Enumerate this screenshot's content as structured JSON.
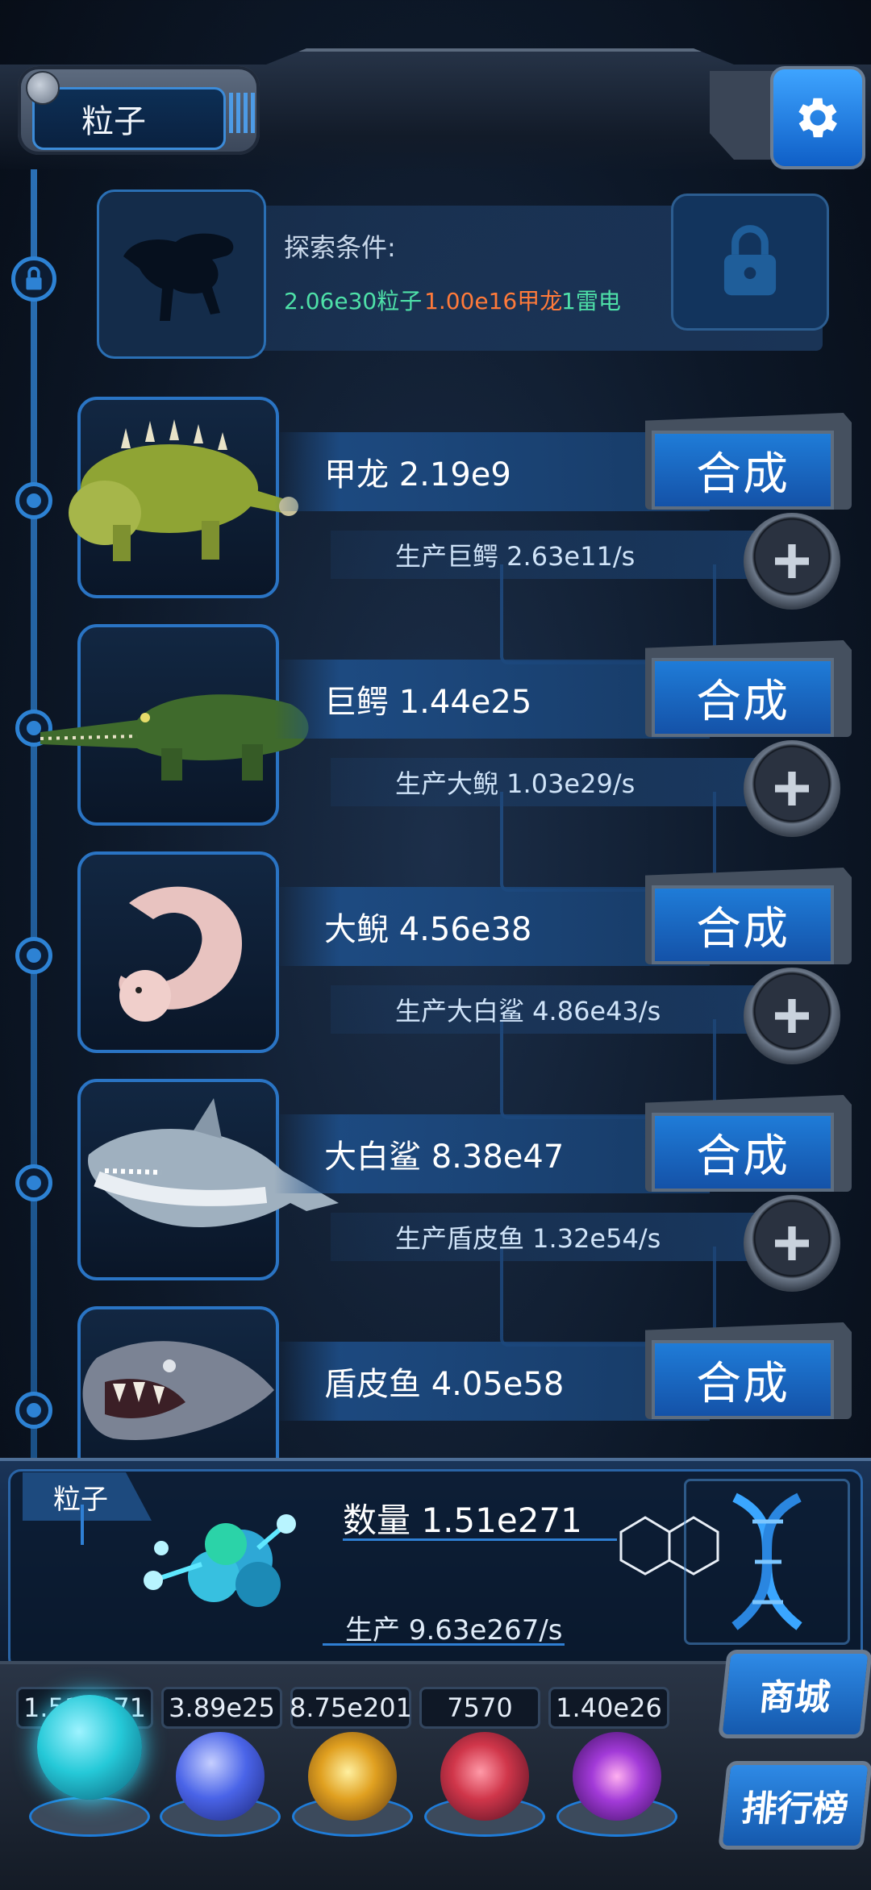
{
  "header": {
    "title": "粒子"
  },
  "explore": {
    "title": "探索条件:",
    "conditions": [
      {
        "text": "2.06e30粒子",
        "color": "#4ee0a8"
      },
      {
        "text": "1.00e16甲龙",
        "color": "#ff7a3a"
      },
      {
        "text": "1雷电",
        "color": "#4ee0a8"
      }
    ]
  },
  "creatures": [
    {
      "name": "甲龙 2.19e9",
      "production": "生产巨鳄 2.63e11/s",
      "button": "合成"
    },
    {
      "name": "巨鳄 1.44e25",
      "production": "生产大鲵 1.03e29/s",
      "button": "合成"
    },
    {
      "name": "大鲵 4.56e38",
      "production": "生产大白鲨 4.86e43/s",
      "button": "合成"
    },
    {
      "name": "大白鲨 8.38e47",
      "production": "生产盾皮鱼 1.32e54/s",
      "button": "合成"
    },
    {
      "name": "盾皮鱼 4.05e58",
      "production": "",
      "button": "合成"
    }
  ],
  "status": {
    "tag": "粒子",
    "quantity": "数量 1.51e271",
    "production": "生产 9.63e267/s"
  },
  "resources": [
    {
      "value": "1.51e271",
      "orb": "particle-orb",
      "color": "#25c9d8"
    },
    {
      "value": "3.89e25",
      "orb": "lightning-orb",
      "color": "#4a64e8"
    },
    {
      "value": "8.75e201",
      "orb": "nebula-orb",
      "color": "#e0a020"
    },
    {
      "value": "7570",
      "orb": "brain-orb",
      "color": "#d0364a"
    },
    {
      "value": "1.40e26",
      "orb": "vortex-orb",
      "color": "#a23ad8"
    }
  ],
  "side_buttons": {
    "shop": "商城",
    "ranking": "排行榜"
  }
}
